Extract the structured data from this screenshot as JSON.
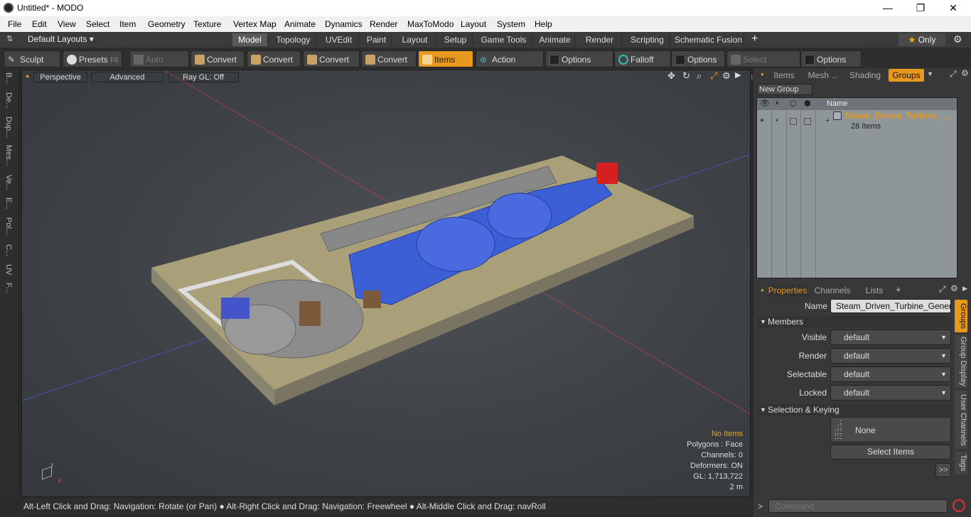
{
  "window": {
    "title": "Untitled* - MODO",
    "minimize": "—",
    "maximize": "❐",
    "close": "✕"
  },
  "menu": [
    "File",
    "Edit",
    "View",
    "Select",
    "Item",
    "Geometry",
    "Texture",
    "Vertex Map",
    "Animate",
    "Dynamics",
    "Render",
    "MaxToModo",
    "Layout",
    "System",
    "Help"
  ],
  "layouts": {
    "label": "Default Layouts",
    "tabs": [
      "Model",
      "Topology",
      "UVEdit",
      "Paint",
      "Layout",
      "Setup",
      "Game Tools",
      "Animate",
      "Render",
      "Scripting",
      "Schematic Fusion"
    ],
    "active": "Model",
    "plus": "+",
    "only": "Only"
  },
  "toolbar": {
    "sculpt": "Sculpt",
    "presets": "Presets",
    "presets_key": "F6",
    "auto_select": "Auto Select",
    "convert1": "Convert",
    "convert2": "Convert",
    "convert3": "Convert",
    "convert4": "Convert",
    "items": "Items",
    "action_center": "Action Center",
    "options1": "Options",
    "falloff": "Falloff",
    "options2": "Options",
    "select_through": "Select Through",
    "options3": "Options"
  },
  "left_strip": [
    "B...",
    "De...",
    "Dup...",
    "Mes...",
    "Ve...",
    "E...",
    "Pol...",
    "C...",
    "UV",
    "F..."
  ],
  "viewport": {
    "perspective": "Perspective",
    "advanced": "Advanced",
    "raygl": "Ray GL: Off",
    "info": {
      "no_items": "No Items",
      "polygons": "Polygons : Face",
      "channels": "Channels: 0",
      "deformers": "Deformers: ON",
      "gl": "GL: 1,713,722",
      "scale": "2 m"
    }
  },
  "status": "Alt-Left Click and Drag: Navigation: Rotate (or Pan) ● Alt-Right Click and Drag: Navigation: Freewheel ● Alt-Middle Click and Drag: navRoll",
  "groups_panel": {
    "tabs": [
      "Items",
      "Mesh ...",
      "Shading",
      "Groups"
    ],
    "active": "Groups",
    "new_group": "New Group",
    "col_name": "Name",
    "item_name": "Steam_Driven_Turbine_ ...",
    "item_count": "28 Items"
  },
  "properties": {
    "tabs": [
      "Properties",
      "Channels",
      "Lists"
    ],
    "plus": "+",
    "name_label": "Name",
    "name_value": "Steam_Driven_Turbine_Generatc",
    "members": "Members",
    "rows": [
      {
        "label": "Visible",
        "value": "default"
      },
      {
        "label": "Render",
        "value": "default"
      },
      {
        "label": "Selectable",
        "value": "default"
      },
      {
        "label": "Locked",
        "value": "default"
      }
    ],
    "selection_keying": "Selection & Keying",
    "none": "None",
    "select_items": "Select Items",
    "more": ">>"
  },
  "side_tabs": [
    "Groups",
    "Group Display",
    "User Channels",
    "Tags"
  ],
  "command": {
    "placeholder": "Command",
    "prompt": ">"
  }
}
